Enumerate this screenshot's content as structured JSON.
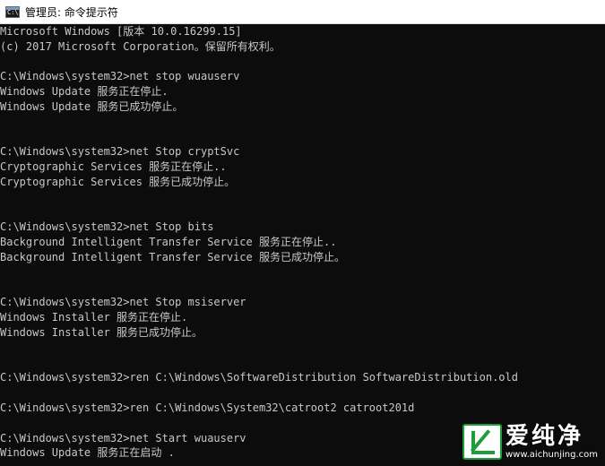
{
  "window": {
    "title": "管理员: 命令提示符",
    "icon_label": "C:\\"
  },
  "console": {
    "lines": [
      "Microsoft Windows [版本 10.0.16299.15]",
      "(c) 2017 Microsoft Corporation。保留所有权利。",
      "",
      "C:\\Windows\\system32>net stop wuauserv",
      "Windows Update 服务正在停止.",
      "Windows Update 服务已成功停止。",
      "",
      "",
      "C:\\Windows\\system32>net Stop cryptSvc",
      "Cryptographic Services 服务正在停止..",
      "Cryptographic Services 服务已成功停止。",
      "",
      "",
      "C:\\Windows\\system32>net Stop bits",
      "Background Intelligent Transfer Service 服务正在停止..",
      "Background Intelligent Transfer Service 服务已成功停止。",
      "",
      "",
      "C:\\Windows\\system32>net Stop msiserver",
      "Windows Installer 服务正在停止.",
      "Windows Installer 服务已成功停止。",
      "",
      "",
      "C:\\Windows\\system32>ren C:\\Windows\\SoftwareDistribution SoftwareDistribution.old",
      "",
      "C:\\Windows\\system32>ren C:\\Windows\\System32\\catroot2 catroot201d",
      "",
      "C:\\Windows\\system32>net Start wuauserv",
      "Windows Update 服务正在启动 ."
    ]
  },
  "watermark": {
    "name": "爱纯净",
    "url": "www.aichunjing.com"
  },
  "colors": {
    "console_bg": "#0c0c0c",
    "console_text": "#c8c8c8",
    "watermark_green": "#1e9e3a"
  },
  "icons": {
    "window_icon": "cmd-icon",
    "watermark_logo": "watermark-logo-icon"
  }
}
